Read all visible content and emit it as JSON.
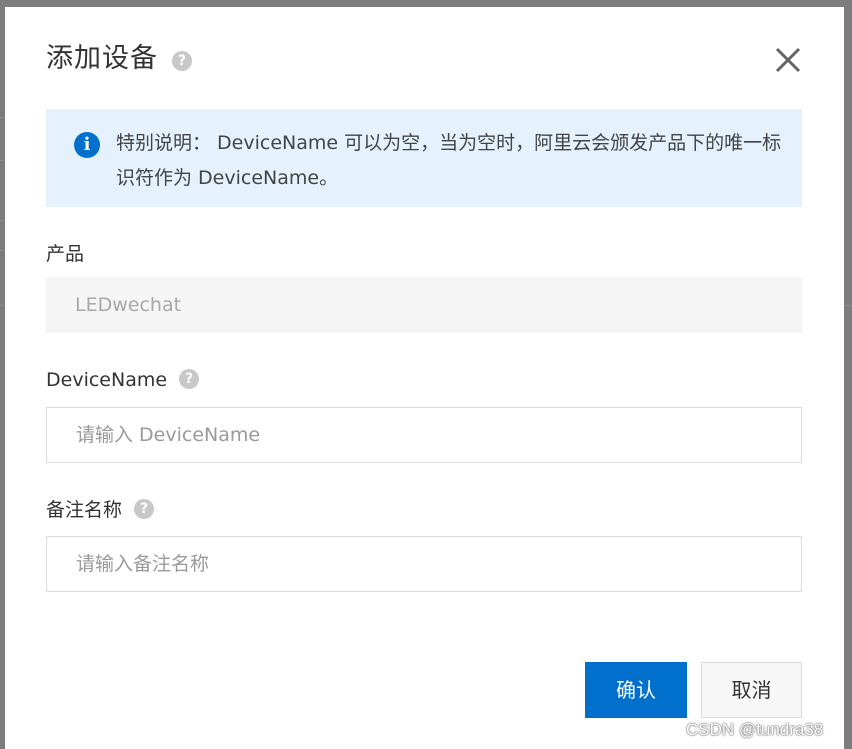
{
  "dialog": {
    "title": "添加设备",
    "title_help_icon": "?",
    "close_icon": "close-icon"
  },
  "info": {
    "icon_glyph": "i",
    "text": "特别说明： DeviceName 可以为空，当为空时，阿里云会颁发产品下的唯一标识符作为 DeviceName。"
  },
  "form": {
    "product": {
      "label": "产品",
      "value": "LEDwechat"
    },
    "device_name": {
      "label": "DeviceName",
      "help_icon": "?",
      "placeholder": "请输入 DeviceName",
      "value": ""
    },
    "remark_name": {
      "label": "备注名称",
      "help_icon": "?",
      "placeholder": "请输入备注名称",
      "value": ""
    }
  },
  "buttons": {
    "confirm": "确认",
    "cancel": "取消"
  },
  "watermark": "CSDN @tundra38",
  "colors": {
    "primary": "#0070cc",
    "info_bg": "#e5f2fd",
    "overlay": "#7f7f7f"
  }
}
